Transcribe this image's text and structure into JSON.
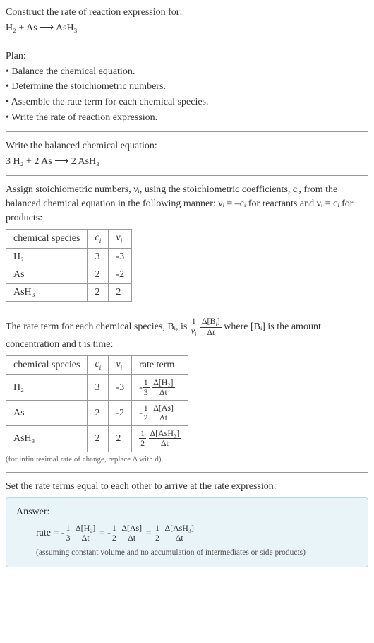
{
  "header": {
    "title": "Construct the rate of reaction expression for:",
    "equation": "H₂ + As ⟶ AsH₃"
  },
  "plan": {
    "heading": "Plan:",
    "items": [
      "• Balance the chemical equation.",
      "• Determine the stoichiometric numbers.",
      "• Assemble the rate term for each chemical species.",
      "• Write the rate of reaction expression."
    ]
  },
  "balanced": {
    "heading": "Write the balanced chemical equation:",
    "equation": "3 H₂ + 2 As ⟶ 2 AsH₃"
  },
  "stoich_intro_1": "Assign stoichiometric numbers, νᵢ, using the stoichiometric coefficients, cᵢ, from the balanced chemical equation in the following manner: νᵢ = –cᵢ for reactants and νᵢ = cᵢ for products:",
  "table1": {
    "headers": [
      "chemical species",
      "cᵢ",
      "νᵢ"
    ],
    "rows": [
      [
        "H₂",
        "3",
        "-3"
      ],
      [
        "As",
        "2",
        "-2"
      ],
      [
        "AsH₃",
        "2",
        "2"
      ]
    ]
  },
  "rate_term_intro_a": "The rate term for each chemical species, Bᵢ, is ",
  "rate_term_intro_b": " where [Bᵢ] is the amount concentration and t is time:",
  "table2": {
    "headers": [
      "chemical species",
      "cᵢ",
      "νᵢ",
      "rate term"
    ],
    "rows": [
      {
        "sp": "H₂",
        "c": "3",
        "v": "-3",
        "sign": "-",
        "coef_num": "1",
        "coef_den": "3",
        "dnum": "Δ[H₂]",
        "dden": "Δt"
      },
      {
        "sp": "As",
        "c": "2",
        "v": "-2",
        "sign": "-",
        "coef_num": "1",
        "coef_den": "2",
        "dnum": "Δ[As]",
        "dden": "Δt"
      },
      {
        "sp": "AsH₃",
        "c": "2",
        "v": "2",
        "sign": "",
        "coef_num": "1",
        "coef_den": "2",
        "dnum": "Δ[AsH₃]",
        "dden": "Δt"
      }
    ],
    "note": "(for infinitesimal rate of change, replace Δ with d)"
  },
  "final_heading": "Set the rate terms equal to each other to arrive at the rate expression:",
  "answer": {
    "label": "Answer:",
    "prefix": "rate = ",
    "terms": [
      {
        "sign": "-",
        "coef_num": "1",
        "coef_den": "3",
        "dnum": "Δ[H₂]",
        "dden": "Δt"
      },
      {
        "sign": "-",
        "coef_num": "1",
        "coef_den": "2",
        "dnum": "Δ[As]",
        "dden": "Δt"
      },
      {
        "sign": "",
        "coef_num": "1",
        "coef_den": "2",
        "dnum": "Δ[AsH₃]",
        "dden": "Δt"
      }
    ],
    "note": "(assuming constant volume and no accumulation of intermediates or side products)"
  }
}
